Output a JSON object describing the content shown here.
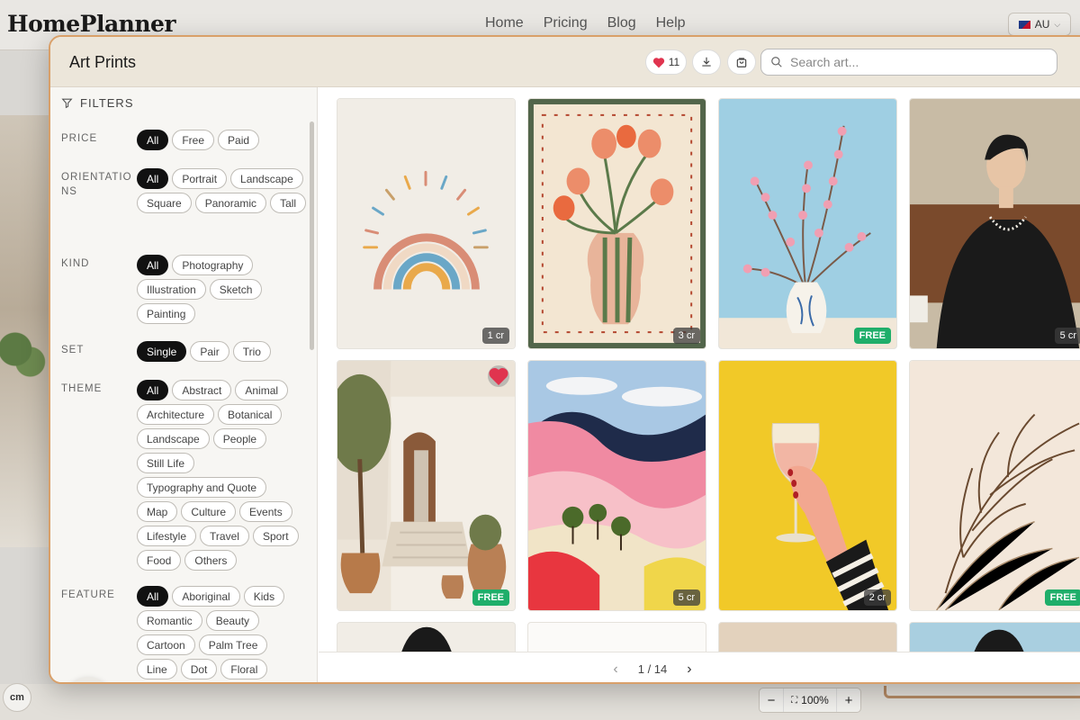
{
  "site": {
    "logo": "HomePlanner",
    "nav": [
      "Home",
      "Pricing",
      "Blog",
      "Help"
    ],
    "locale": "AU",
    "cm_label": "cm",
    "zoom": "100%"
  },
  "modal": {
    "title": "Art Prints",
    "favorites_count": "11",
    "search_placeholder": "Search art..."
  },
  "filters": {
    "header": "FILTERS",
    "groups": [
      {
        "label": "PRICE",
        "options": [
          "All",
          "Free",
          "Paid"
        ],
        "selected": "All"
      },
      {
        "label": "ORIENTATIO NS",
        "options": [
          "All",
          "Portrait",
          "Landscape",
          "Square",
          "Panoramic",
          "Tall"
        ],
        "selected": "All"
      },
      {
        "label": "KIND",
        "options": [
          "All",
          "Photography",
          "Illustration",
          "Sketch",
          "Painting"
        ],
        "selected": "All"
      },
      {
        "label": "SET",
        "options": [
          "Single",
          "Pair",
          "Trio"
        ],
        "selected": "Single"
      },
      {
        "label": "THEME",
        "options": [
          "All",
          "Abstract",
          "Animal",
          "Architecture",
          "Botanical",
          "Landscape",
          "People",
          "Still Life",
          "Typography and Quote",
          "Map",
          "Culture",
          "Events",
          "Lifestyle",
          "Travel",
          "Sport",
          "Food",
          "Others"
        ],
        "selected": "All"
      },
      {
        "label": "FEATURE",
        "options": [
          "All",
          "Aboriginal",
          "Kids",
          "Romantic",
          "Beauty",
          "Cartoon",
          "Palm Tree",
          "Line",
          "Dot",
          "Floral"
        ],
        "selected": "All"
      }
    ]
  },
  "artworks": [
    {
      "subject": "rainbow",
      "price": "1 cr",
      "free": false
    },
    {
      "subject": "tulip-vase",
      "price": "3 cr",
      "free": false
    },
    {
      "subject": "cherry-blossom",
      "price": "FREE",
      "free": true
    },
    {
      "subject": "woman-portrait",
      "price": "5 cr",
      "free": false
    },
    {
      "subject": "mediterranean-courtyard",
      "price": "FREE",
      "free": true,
      "favorited": true
    },
    {
      "subject": "pink-hills",
      "price": "5 cr",
      "free": false
    },
    {
      "subject": "wine-glass",
      "price": "2 cr",
      "free": false
    },
    {
      "subject": "palm-leaves",
      "price": "FREE",
      "free": true
    }
  ],
  "pagination": {
    "label": "1 / 14",
    "prev": "‹",
    "next": "›"
  }
}
